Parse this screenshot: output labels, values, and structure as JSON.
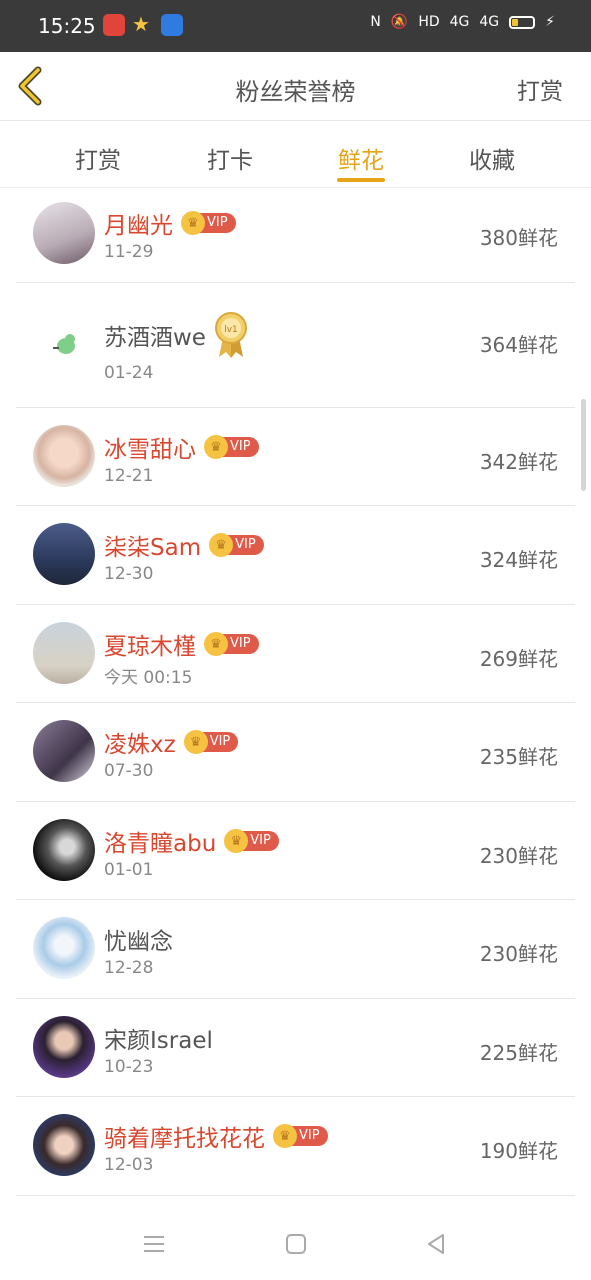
{
  "status_bar": {
    "time": "15:25",
    "network_text": "HD",
    "signal_1": "4G",
    "signal_2": "4G"
  },
  "header": {
    "title": "粉丝荣誉榜",
    "right_button": "打赏"
  },
  "tabs": [
    {
      "label": "打赏",
      "active": false
    },
    {
      "label": "打卡",
      "active": false
    },
    {
      "label": "鲜花",
      "active": true
    },
    {
      "label": "收藏",
      "active": false
    }
  ],
  "vip_label": "VIP",
  "level_label": "lv1",
  "fans": [
    {
      "name": "月幽光",
      "vip": true,
      "date": "11-29",
      "count": "380鲜花"
    },
    {
      "name": "苏酒酒we",
      "vip": false,
      "level_badge": true,
      "date": "01-24",
      "count": "364鲜花"
    },
    {
      "name": "冰雪甜心",
      "vip": true,
      "date": "12-21",
      "count": "342鲜花"
    },
    {
      "name": "柒柒Sam",
      "vip": true,
      "date": "12-30",
      "count": "324鲜花"
    },
    {
      "name": "夏琼木槿",
      "vip": true,
      "date": "今天 00:15",
      "count": "269鲜花"
    },
    {
      "name": "凌姝xz",
      "vip": true,
      "date": "07-30",
      "count": "235鲜花"
    },
    {
      "name": "洛青瞳abu",
      "vip": true,
      "date": "01-01",
      "count": "230鲜花"
    },
    {
      "name": "忧幽念",
      "vip": false,
      "date": "12-28",
      "count": "230鲜花"
    },
    {
      "name": "宋颜Israel",
      "vip": false,
      "date": "10-23",
      "count": "225鲜花"
    },
    {
      "name": "骑着摩托找花花",
      "vip": true,
      "date": "12-03",
      "count": "190鲜花"
    }
  ],
  "colors": {
    "accent": "#e8a317",
    "vip_name": "#d9472f",
    "status_bar_bg": "#3a3a3a"
  }
}
